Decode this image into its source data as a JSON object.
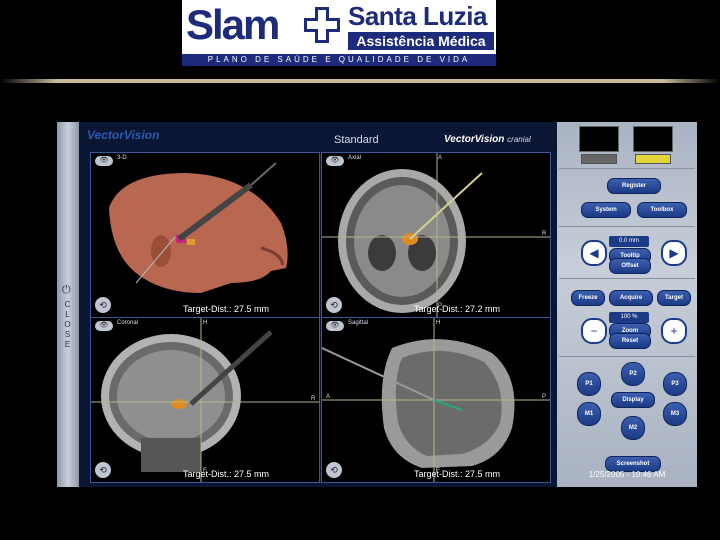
{
  "logo": {
    "slam": "Slam",
    "brand_top": "Santa Luzia",
    "brand_bottom": "Assistência Médica",
    "tagline": "PLANO DE SAÚDE E QUALIDADE DE VIDA"
  },
  "app": {
    "brand": "VectorVision",
    "mode": "Standard",
    "product": "VectorVision",
    "product_suffix": "cranial",
    "close_label": "CLOSE",
    "power_icon": "power-icon"
  },
  "views": [
    {
      "label": "3-D",
      "distance": "Target-Dist.: 27.5 mm"
    },
    {
      "label": "Axial",
      "distance": "Target-Dist.: 27.2 mm"
    },
    {
      "label": "Coronal",
      "distance": "Target-Dist.: 27.5 mm"
    },
    {
      "label": "Sagittal",
      "distance": "Target-Dist.: 27.5 mm"
    }
  ],
  "axis_letters": {
    "a": "A",
    "r": "R",
    "p": "P",
    "f": "F",
    "h": "H"
  },
  "panel": {
    "register": "Register",
    "system": "System",
    "toolbox": "Toolbox",
    "distance_readout": "0.0 mm",
    "tooltip": "Tooltip",
    "offset": "Offset",
    "freeze": "Freeze",
    "acquire": "Acquire",
    "target": "Target",
    "zoom_readout": "100 %",
    "zoom": "Zoom",
    "reset": "Reset",
    "p1": "P1",
    "p2": "P2",
    "p3": "P3",
    "m1": "M1",
    "m2": "M2",
    "m3": "M3",
    "display": "Display",
    "screenshot": "Screenshot",
    "datetime": "1/25/2005 - 10:46 AM"
  }
}
